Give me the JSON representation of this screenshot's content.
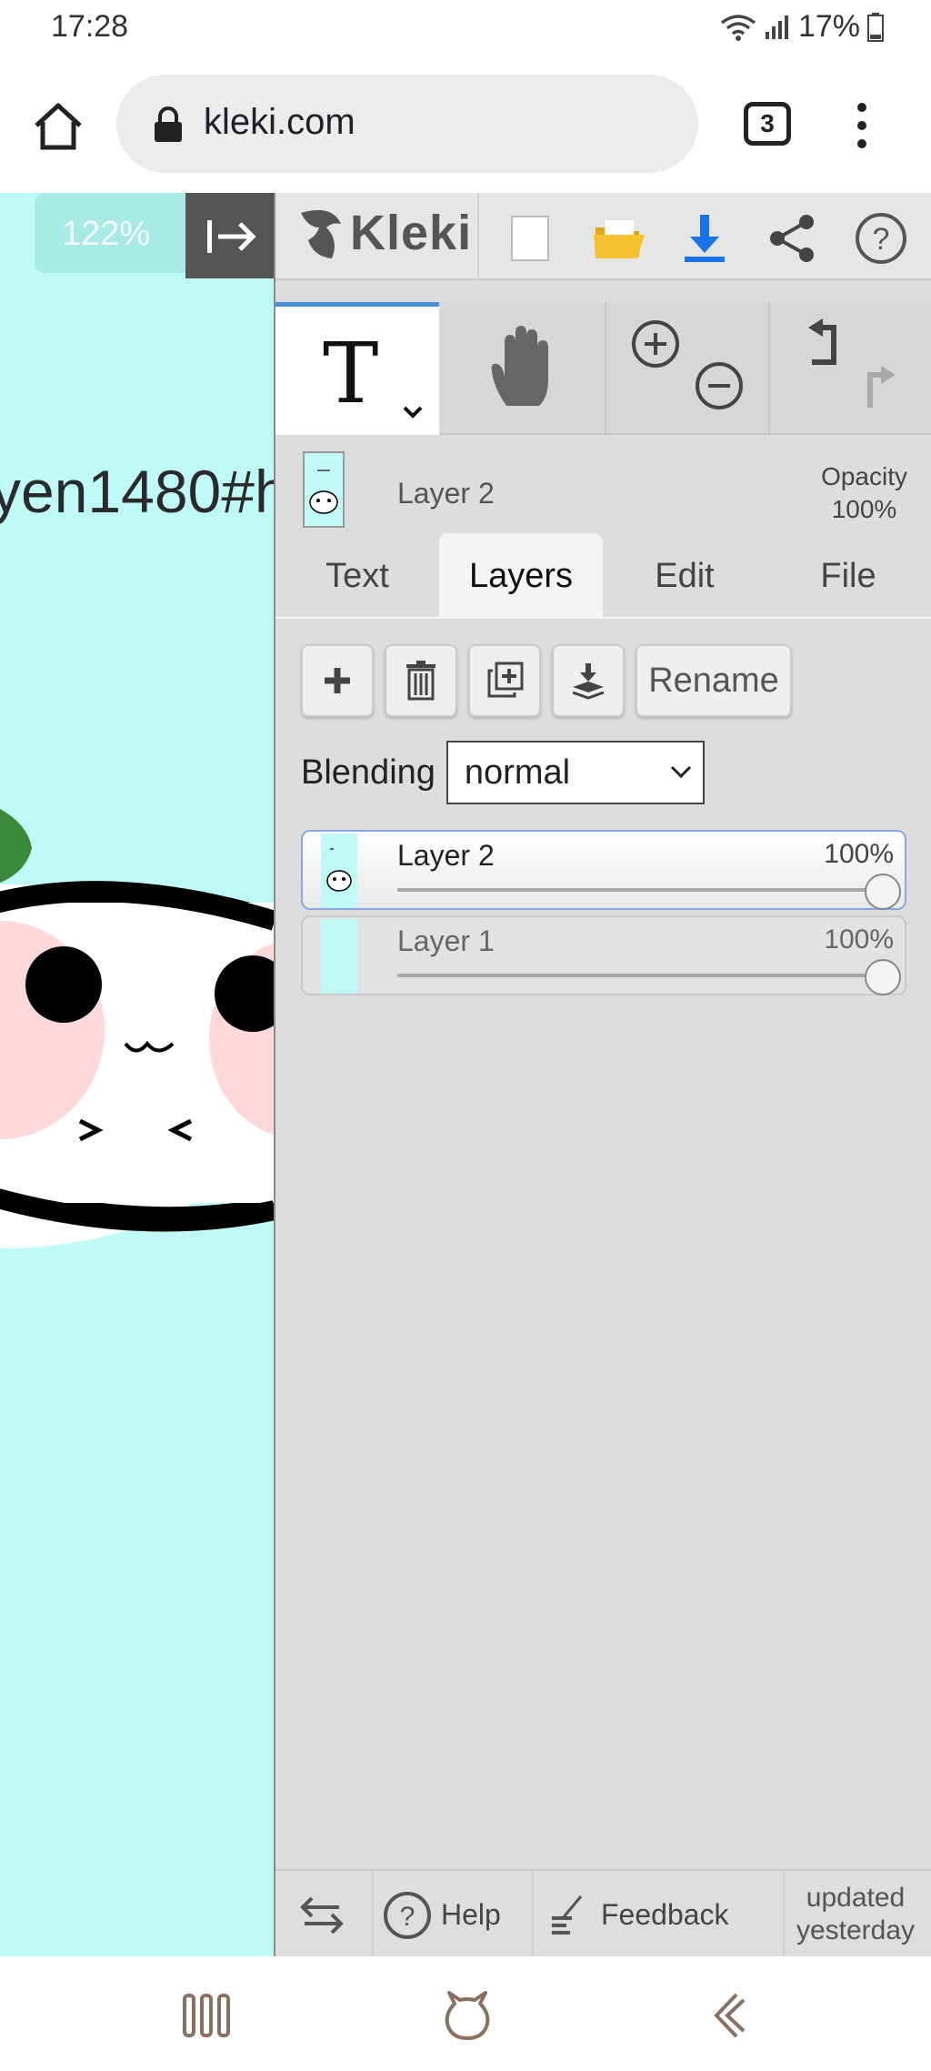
{
  "status_bar": {
    "time": "17:28",
    "battery": "17%"
  },
  "browser": {
    "url": "kleki.com",
    "tab_count": "3"
  },
  "canvas": {
    "zoom": "122%",
    "visible_text": "yen1480#h"
  },
  "app": {
    "logo": "Kleki"
  },
  "layer_info": {
    "name": "Layer 2",
    "opacity_label": "Opacity",
    "opacity_value": "100%"
  },
  "tabs": [
    "Text",
    "Layers",
    "Edit",
    "File"
  ],
  "active_tab": "Layers",
  "layer_buttons": {
    "rename": "Rename"
  },
  "blending": {
    "label": "Blending",
    "value": "normal"
  },
  "layers": [
    {
      "name": "Layer 2",
      "opacity": "100%",
      "selected": true
    },
    {
      "name": "Layer 1",
      "opacity": "100%",
      "selected": false
    }
  ],
  "bottom_bar": {
    "help": "Help",
    "feedback": "Feedback",
    "updated_line1": "updated",
    "updated_line2": "yesterday"
  },
  "colors": {
    "canvas_bg": "#bffaf6",
    "accent": "#4a90e2",
    "download": "#1a73e8",
    "folder": "#f5c12e"
  }
}
